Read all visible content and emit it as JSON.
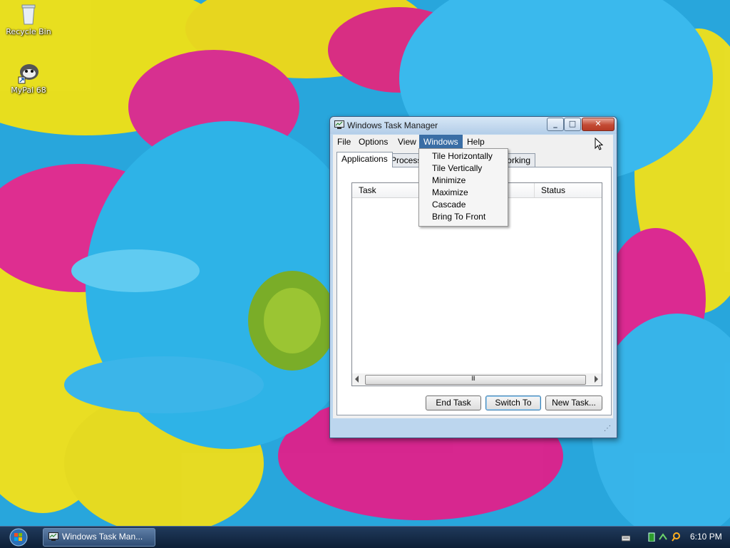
{
  "desktop": {
    "icons": [
      {
        "label": "Recycle Bin",
        "icon": "recycle-bin-icon"
      },
      {
        "label": "MyPal 68",
        "icon": "mypal-browser-icon"
      }
    ]
  },
  "window": {
    "title": "Windows Task Manager",
    "menubar": [
      "File",
      "Options",
      "View",
      "Windows",
      "Help"
    ],
    "active_menu": "Windows",
    "tabs": [
      "Applications",
      "Processes",
      "Networking"
    ],
    "selected_tab": "Applications",
    "columns": [
      "Task",
      "Status"
    ],
    "scroll_grip": "III",
    "buttons": {
      "end_task": "End Task",
      "switch_to": "Switch To",
      "new_task": "New Task..."
    }
  },
  "windows_menu": [
    "Tile Horizontally",
    "Tile Vertically",
    "Minimize",
    "Maximize",
    "Cascade",
    "Bring To Front"
  ],
  "taskbar": {
    "task_button": "Windows Task Man...",
    "clock": "6:10 PM",
    "tray_icons": [
      "keyboard-icon",
      "battery-icon",
      "network-icon",
      "search-icon"
    ]
  },
  "colors": {
    "menu_highlight": "#3a6ea5",
    "taskbar": "#0d1f36",
    "window_frame": "#bcd6ee",
    "close_button": "#c34a34"
  }
}
